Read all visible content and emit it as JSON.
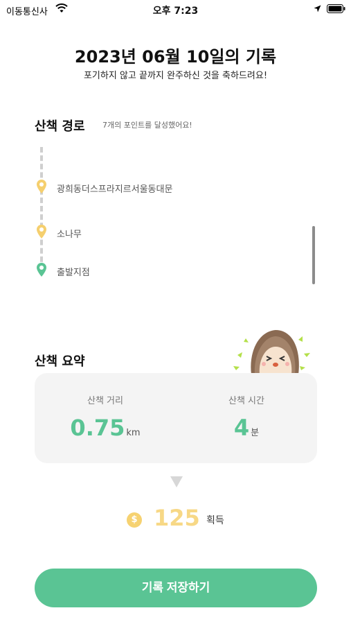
{
  "status_bar": {
    "carrier": "이동통신사",
    "time": "오후 7:23",
    "icons": [
      "wifi-icon",
      "location-icon",
      "battery-icon"
    ]
  },
  "header": {
    "title": "2023년 06월 10일의 기록",
    "subtitle": "포기하지 않고 끝까지 완주하신 것을 축하드려요!"
  },
  "route": {
    "title": "산책 경로",
    "summary": "7개의 포인트를 달성했어요!",
    "points": [
      {
        "label": "광희동더스프라지르서울동대문",
        "icon": "pin-icon",
        "color": "#f5cf6e"
      },
      {
        "label": "소나무",
        "icon": "pin-icon",
        "color": "#f5cf6e"
      },
      {
        "label": "출발지점",
        "icon": "pin-icon",
        "color": "#5ac494"
      }
    ]
  },
  "summary": {
    "title": "산책 요약",
    "distance": {
      "label": "산책 거리",
      "value": "0.75",
      "unit": "km"
    },
    "time": {
      "label": "산책 시간",
      "value": "4",
      "unit": "분"
    }
  },
  "reward": {
    "coin_symbol": "$",
    "value": "125",
    "label": "획득"
  },
  "actions": {
    "save_label": "기록 저장하기"
  },
  "colors": {
    "accent": "#5ac494",
    "coin": "#f6d271",
    "pin_yellow": "#f5cf6e"
  }
}
